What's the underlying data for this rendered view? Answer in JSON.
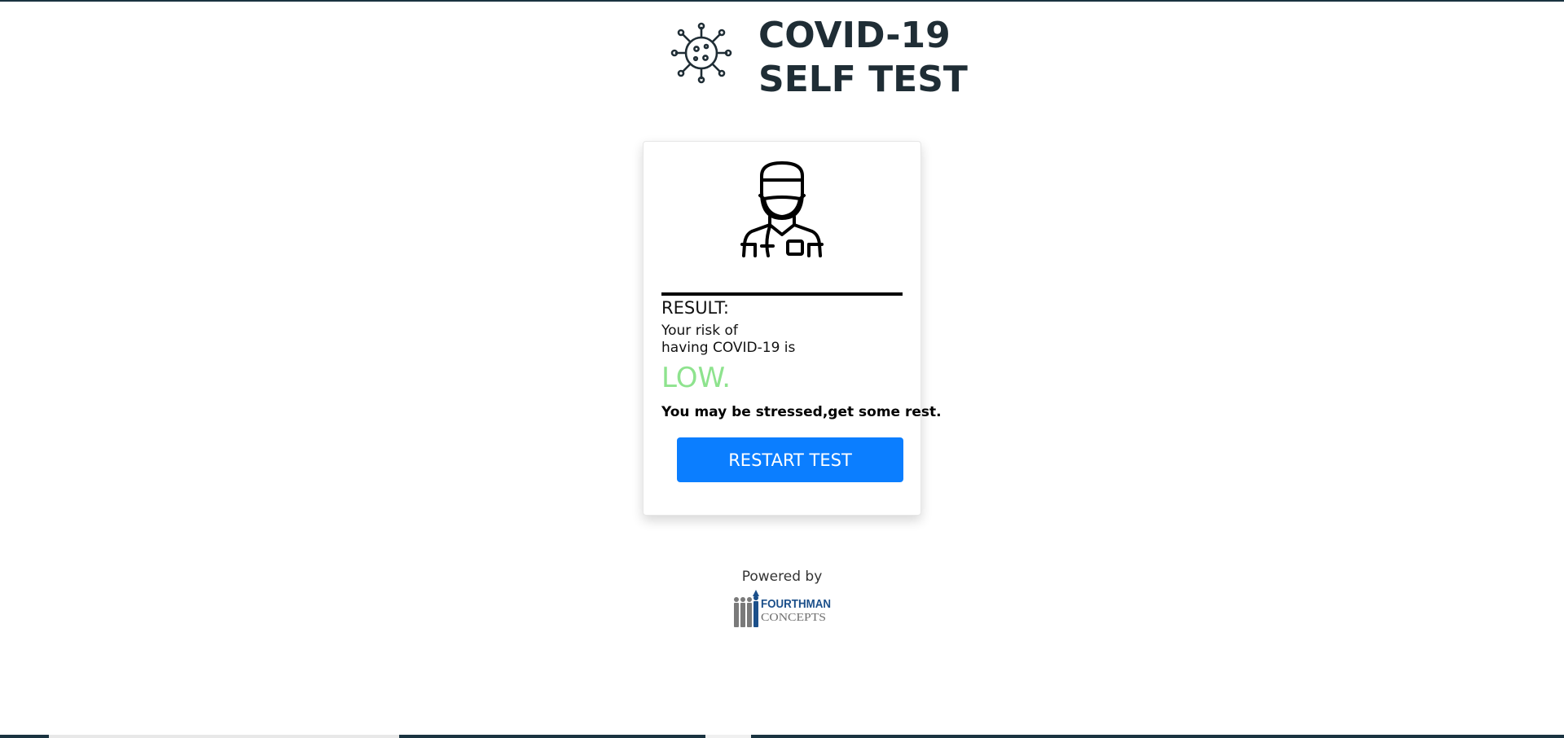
{
  "header": {
    "title_line1": "COVID-19",
    "title_line2": "SELF TEST",
    "icon": "virus-icon"
  },
  "card": {
    "icon": "doctor-with-mask-icon",
    "result_label": "RESULT:",
    "risk_text_line1": "Your risk of",
    "risk_text_line2": "having COVID-19 is",
    "risk_level": "LOW.",
    "advice": "You may be stressed,get some rest.",
    "restart_label": "RESTART TEST"
  },
  "footer": {
    "powered_by": "Powered by",
    "logo_line1": "FOURTHMAN",
    "logo_line2": "CONCEPTS"
  },
  "colors": {
    "title": "#1f2d35",
    "risk_low": "#8ee38e",
    "button": "#0b7eff",
    "logo_blue": "#1b4f8a",
    "logo_grey": "#6e6e6e"
  }
}
